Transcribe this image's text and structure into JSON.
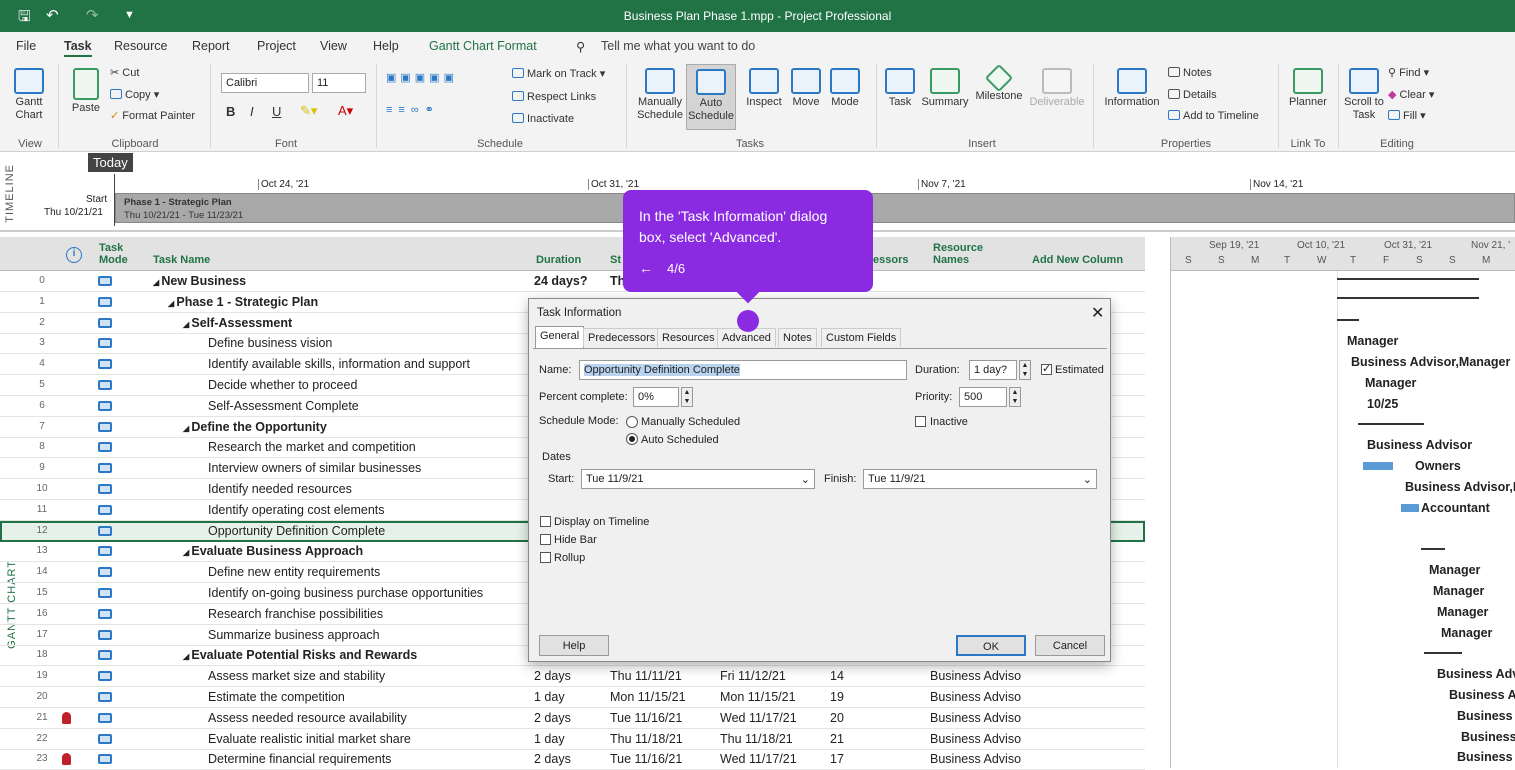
{
  "titlebar": {
    "title": "Business Plan Phase 1.mpp  -  Project Professional"
  },
  "menu": [
    "File",
    "Task",
    "Resource",
    "Report",
    "Project",
    "View",
    "Help",
    "Gantt Chart Format"
  ],
  "tell_me": "Tell me what you want to do",
  "ribbon": {
    "view": {
      "gantt": "Gantt Chart",
      "group": "View"
    },
    "clipboard": {
      "paste": "Paste",
      "cut": "Cut",
      "copy": "Copy",
      "format_painter": "Format Painter",
      "group": "Clipboard"
    },
    "font": {
      "name": "Calibri",
      "size": "11",
      "group": "Font"
    },
    "schedule": {
      "mark": "Mark on Track",
      "respect": "Respect Links",
      "inactivate": "Inactivate",
      "group": "Schedule"
    },
    "tasks": {
      "manual": "Manually Schedule",
      "auto": "Auto Schedule",
      "inspect": "Inspect",
      "move": "Move",
      "mode": "Mode",
      "group": "Tasks"
    },
    "insert": {
      "task": "Task",
      "summary": "Summary",
      "milestone": "Milestone",
      "deliverable": "Deliverable",
      "group": "Insert"
    },
    "properties": {
      "information": "Information",
      "notes": "Notes",
      "details": "Details",
      "add_timeline": "Add to Timeline",
      "group": "Properties"
    },
    "linkto": {
      "planner": "Planner",
      "group": "Link To"
    },
    "editing": {
      "scroll": "Scroll to Task",
      "find": "Find",
      "clear": "Clear",
      "fill": "Fill",
      "group": "Editing"
    }
  },
  "timeline": {
    "label": "TIMELINE",
    "today": "Today",
    "start_label": "Start",
    "start_date": "Thu 10/21/21",
    "dates": [
      "Oct 24, '21",
      "Oct 31, '21",
      "Nov 7, '21",
      "Nov 14, '21"
    ],
    "bar_title": "Phase 1 - Strategic Plan",
    "bar_range": "Thu 10/21/21 - Tue 11/23/21"
  },
  "grid": {
    "vlabel": "GANTT CHART",
    "headers": {
      "mode": "Task Mode",
      "name": "Task Name",
      "duration": "Duration",
      "start": "St",
      "pred": "essors",
      "res": "Resource Names",
      "add": "Add New Column"
    },
    "rows": [
      {
        "id": "0",
        "name": "New Business",
        "level": 0,
        "summary": true,
        "dur": "24 days?",
        "start": "Th",
        "finish": "",
        "pred": "",
        "res": ""
      },
      {
        "id": "1",
        "name": "Phase 1 - Strategic Plan",
        "level": 1,
        "summary": true,
        "dur": "",
        "start": "",
        "finish": "",
        "pred": "",
        "res": ""
      },
      {
        "id": "2",
        "name": "Self-Assessment",
        "level": 2,
        "summary": true,
        "dur": "",
        "start": "",
        "finish": "",
        "pred": "",
        "res": ""
      },
      {
        "id": "3",
        "name": "Define business vision",
        "level": 3,
        "dur": "",
        "start": "",
        "finish": "",
        "pred": "",
        "res": ""
      },
      {
        "id": "4",
        "name": "Identify available skills, information and support",
        "level": 3,
        "dur": "",
        "start": "",
        "finish": "",
        "pred": "",
        "res": ""
      },
      {
        "id": "5",
        "name": "Decide whether to proceed",
        "level": 3,
        "dur": "",
        "start": "",
        "finish": "",
        "pred": "",
        "res": ""
      },
      {
        "id": "6",
        "name": "Self-Assessment Complete",
        "level": 3,
        "dur": "",
        "start": "",
        "finish": "",
        "pred": "",
        "res": ""
      },
      {
        "id": "7",
        "name": "Define the Opportunity",
        "level": 2,
        "summary": true,
        "dur": "",
        "start": "",
        "finish": "",
        "pred": "",
        "res": ""
      },
      {
        "id": "8",
        "name": "Research the market and competition",
        "level": 3,
        "dur": "",
        "start": "",
        "finish": "",
        "pred": "",
        "res": ""
      },
      {
        "id": "9",
        "name": "Interview owners of similar businesses",
        "level": 3,
        "dur": "",
        "start": "",
        "finish": "",
        "pred": "",
        "res": ""
      },
      {
        "id": "10",
        "name": "Identify needed resources",
        "level": 3,
        "dur": "",
        "start": "",
        "finish": "",
        "pred": "",
        "res": ""
      },
      {
        "id": "11",
        "name": "Identify operating cost elements",
        "level": 3,
        "dur": "",
        "start": "",
        "finish": "",
        "pred": "",
        "res": ""
      },
      {
        "id": "12",
        "name": "Opportunity Definition Complete",
        "level": 3,
        "selected": true,
        "dur": "",
        "start": "",
        "finish": "",
        "pred": "",
        "res": ""
      },
      {
        "id": "13",
        "name": "Evaluate Business Approach",
        "level": 2,
        "summary": true,
        "dur": "",
        "start": "",
        "finish": "",
        "pred": "",
        "res": ""
      },
      {
        "id": "14",
        "name": "Define new entity requirements",
        "level": 3,
        "dur": "",
        "start": "",
        "finish": "",
        "pred": "",
        "res": ""
      },
      {
        "id": "15",
        "name": "Identify on-going business purchase opportunities",
        "level": 3,
        "dur": "",
        "start": "",
        "finish": "",
        "pred": "",
        "res": ""
      },
      {
        "id": "16",
        "name": "Research franchise possibilities",
        "level": 3,
        "dur": "",
        "start": "",
        "finish": "",
        "pred": "",
        "res": ""
      },
      {
        "id": "17",
        "name": "Summarize business approach",
        "level": 3,
        "dur": "",
        "start": "",
        "finish": "",
        "pred": "",
        "res": ""
      },
      {
        "id": "18",
        "name": "Evaluate Potential Risks and Rewards",
        "level": 2,
        "summary": true,
        "dur": "",
        "start": "",
        "finish": "",
        "pred": "",
        "res": ""
      },
      {
        "id": "19",
        "name": "Assess market size and stability",
        "level": 3,
        "dur": "2 days",
        "start": "Thu 11/11/21",
        "finish": "Fri 11/12/21",
        "pred": "14",
        "res": "Business Adviso"
      },
      {
        "id": "20",
        "name": "Estimate the competition",
        "level": 3,
        "dur": "1 day",
        "start": "Mon 11/15/21",
        "finish": "Mon 11/15/21",
        "pred": "19",
        "res": "Business Adviso"
      },
      {
        "id": "21",
        "name": "Assess needed resource availability",
        "level": 3,
        "person": true,
        "dur": "2 days",
        "start": "Tue 11/16/21",
        "finish": "Wed 11/17/21",
        "pred": "20",
        "res": "Business Adviso"
      },
      {
        "id": "22",
        "name": "Evaluate realistic initial market share",
        "level": 3,
        "dur": "1 day",
        "start": "Thu 11/18/21",
        "finish": "Thu 11/18/21",
        "pred": "21",
        "res": "Business Adviso"
      },
      {
        "id": "23",
        "name": "Determine financial requirements",
        "level": 3,
        "person": true,
        "dur": "2 days",
        "start": "Tue 11/16/21",
        "finish": "Wed 11/17/21",
        "pred": "17",
        "res": "Business Adviso"
      }
    ]
  },
  "gantt": {
    "months": [
      "Sep 19, '21",
      "Oct 10, '21",
      "Oct 31, '21",
      "Nov 21, '"
    ],
    "days": [
      "S",
      "S",
      "M",
      "T",
      "W",
      "T",
      "F",
      "S",
      "S",
      "M"
    ],
    "labels": [
      {
        "row": 3,
        "text": "Manager"
      },
      {
        "row": 4,
        "text": "Business Advisor,Manager"
      },
      {
        "row": 5,
        "text": "Manager"
      },
      {
        "row": 6,
        "text": "10/25"
      },
      {
        "row": 8,
        "text": "Business Advisor"
      },
      {
        "row": 9,
        "text": "Owners"
      },
      {
        "row": 10,
        "text": "Business Advisor,P"
      },
      {
        "row": 11,
        "text": "Accountant"
      },
      {
        "row": 14,
        "text": "Manager"
      },
      {
        "row": 15,
        "text": "Manager"
      },
      {
        "row": 16,
        "text": "Manager"
      },
      {
        "row": 17,
        "text": "Manager"
      },
      {
        "row": 19,
        "text": "Business Adv"
      },
      {
        "row": 20,
        "text": "Business A"
      },
      {
        "row": 21,
        "text": "Business"
      },
      {
        "row": 22,
        "text": "Business"
      },
      {
        "row": 23,
        "text": "Business"
      }
    ]
  },
  "dialog": {
    "title": "Task Information",
    "tabs": [
      "General",
      "Predecessors",
      "Resources",
      "Advanced",
      "Notes",
      "Custom Fields"
    ],
    "name_label": "Name:",
    "name_value": "Opportunity Definition Complete",
    "duration_label": "Duration:",
    "duration_value": "1 day?",
    "estimated": "Estimated",
    "percent_label": "Percent complete:",
    "percent_value": "0%",
    "priority_label": "Priority:",
    "priority_value": "500",
    "schedule_mode_label": "Schedule Mode:",
    "manual": "Manually Scheduled",
    "auto": "Auto Scheduled",
    "inactive": "Inactive",
    "dates_label": "Dates",
    "start_label": "Start:",
    "start_value": "Tue 11/9/21",
    "finish_label": "Finish:",
    "finish_value": "Tue 11/9/21",
    "display_timeline": "Display on Timeline",
    "hide_bar": "Hide Bar",
    "rollup": "Rollup",
    "help": "Help",
    "ok": "OK",
    "cancel": "Cancel"
  },
  "tooltip": {
    "text": "In the 'Task Information' dialog box, select 'Advanced'.",
    "step": "4/6",
    "back": "←"
  }
}
